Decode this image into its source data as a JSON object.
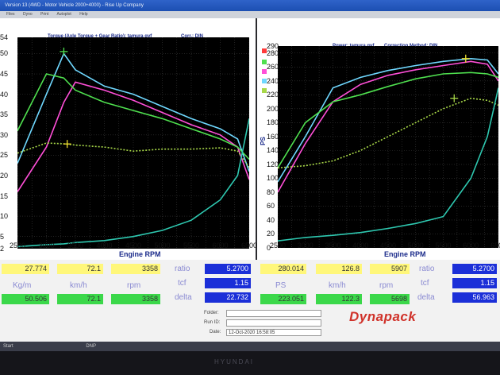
{
  "window": {
    "title": "Version 13 (4WD - Motor Vehicle 2000+4000) - Rise Up Company",
    "menu": [
      "Files",
      "Dyno",
      "Print",
      "Autoplot",
      "Help"
    ]
  },
  "left_panel": {
    "title": "Torque (Axle Torque + Gear Ratio): tamura gvf",
    "subtitle": "Corr.: DIN",
    "xlabel": "Engine RPM",
    "y_ticks": [
      "54",
      "50",
      "45",
      "40",
      "35",
      "30",
      "25",
      "20",
      "15",
      "10",
      "5",
      "2"
    ],
    "x_ticks": [
      "2500",
      "3000",
      "3500",
      "4000",
      "4500",
      "5000",
      "5500",
      "6000",
      "6500"
    ]
  },
  "right_panel": {
    "title": "Power: tamura gvf",
    "subtitle": "Correction Method: DIN",
    "xlabel": "Engine RPM",
    "ylabel": "PS",
    "y_ticks": [
      "290",
      "280",
      "260",
      "240",
      "220",
      "200",
      "180",
      "160",
      "140",
      "120",
      "100",
      "80",
      "60",
      "40",
      "20",
      "0"
    ],
    "x_ticks": [
      "2500",
      "3000",
      "3500",
      "4000",
      "4500",
      "5000",
      "5500",
      "6000",
      "6500"
    ]
  },
  "colors": {
    "cyan": "#6fd8ff",
    "magenta": "#ff4fd8",
    "green": "#4fe04f",
    "olive": "#a8d848",
    "teal": "#2ec8b0",
    "cursor": "#f0e030"
  },
  "chart_data": [
    {
      "type": "line",
      "title": "Torque (Axle Torque + Gear Ratio): tamura gvf",
      "xlabel": "Engine RPM",
      "ylabel": "",
      "xlim": [
        2500,
        6500
      ],
      "ylim": [
        2,
        54
      ],
      "grid": true,
      "x": [
        2500,
        3000,
        3300,
        3500,
        4000,
        4500,
        5000,
        5500,
        6000,
        6300,
        6500
      ],
      "series": [
        {
          "values": [
            23.0,
            40.0,
            50.0,
            46.0,
            42.0,
            40.0,
            37.0,
            34.0,
            31.5,
            29.0,
            21.0
          ]
        },
        {
          "values": [
            16.0,
            27.0,
            38.0,
            43.0,
            41.0,
            38.5,
            35.5,
            32.5,
            30.0,
            27.0,
            19.0
          ]
        },
        {
          "values": [
            31.0,
            45.0,
            44.0,
            41.0,
            38.0,
            36.0,
            34.0,
            31.5,
            29.0,
            27.0,
            24.0
          ]
        },
        {
          "values": [
            25.5,
            28.0,
            27.8,
            27.5,
            27.0,
            26.0,
            26.5,
            26.5,
            26.8,
            26.0,
            22.0
          ]
        },
        {
          "values": [
            2.5,
            3.0,
            3.2,
            3.5,
            4.0,
            5.0,
            6.5,
            9.0,
            14.0,
            20.0,
            34.0
          ]
        }
      ]
    },
    {
      "type": "line",
      "title": "Power: tamura gvf",
      "xlabel": "Engine RPM",
      "ylabel": "PS",
      "xlim": [
        2500,
        6500
      ],
      "ylim": [
        0,
        290
      ],
      "grid": true,
      "x": [
        2500,
        3000,
        3500,
        4000,
        4500,
        5000,
        5500,
        6000,
        6300,
        6500
      ],
      "series": [
        {
          "values": [
            95,
            160,
            230,
            245,
            255,
            262,
            268,
            272,
            270,
            250
          ]
        },
        {
          "values": [
            80,
            150,
            210,
            235,
            248,
            256,
            262,
            268,
            264,
            240
          ]
        },
        {
          "values": [
            115,
            180,
            210,
            220,
            232,
            243,
            250,
            252,
            250,
            245
          ]
        },
        {
          "values": [
            115,
            118,
            125,
            140,
            160,
            180,
            200,
            215,
            212,
            205
          ]
        },
        {
          "values": [
            10,
            15,
            18,
            22,
            28,
            35,
            45,
            100,
            160,
            230
          ]
        }
      ]
    }
  ],
  "readouts_left": {
    "row1": [
      "27.774",
      "72.1",
      "3358"
    ],
    "units": [
      "Kg/m",
      "km/h",
      "rpm"
    ],
    "row2": [
      "50.506",
      "72.1",
      "3358"
    ],
    "labels": [
      "ratio",
      "tcf",
      "delta"
    ],
    "values": [
      "5.2700",
      "1.15",
      "22.732"
    ]
  },
  "readouts_right": {
    "row1": [
      "280.014",
      "126.8",
      "5907"
    ],
    "units": [
      "PS",
      "km/h",
      "rpm"
    ],
    "row2": [
      "223.051",
      "122.3",
      "5698"
    ],
    "labels": [
      "ratio",
      "tcf",
      "delta"
    ],
    "values": [
      "5.2700",
      "1.15",
      "56.963"
    ]
  },
  "info": {
    "folder_label": "Folder:",
    "runid_label": "Run ID:",
    "date_label": "Date:",
    "date_value": "12-Oct-2020 16:58:05"
  },
  "logo_text": "Dynapack",
  "taskbar": {
    "start": "Start",
    "item": "DNP"
  },
  "monitor_brand": "HYUNDAI"
}
